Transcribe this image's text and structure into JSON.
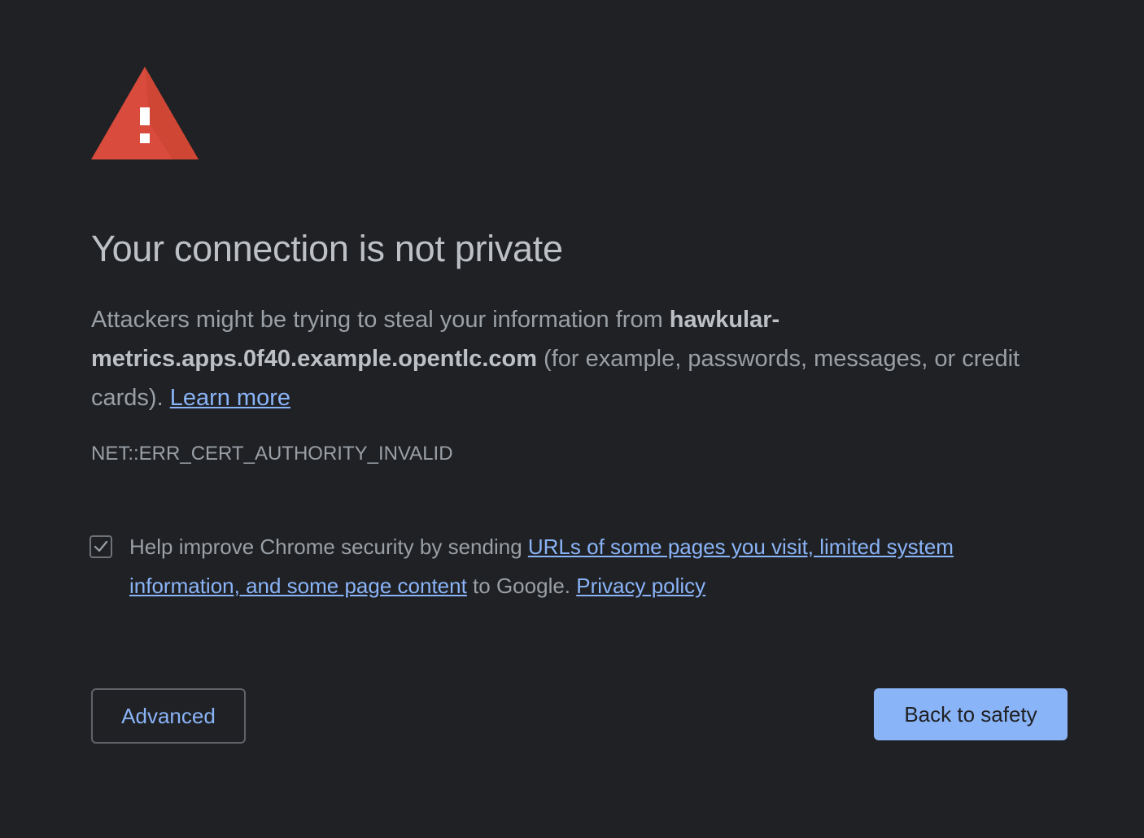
{
  "interstitial": {
    "icon": "warning-triangle-icon",
    "title": "Your connection is not private",
    "message": {
      "prefix": "Attackers might be trying to steal your information from ",
      "hostname": "hawkular-metrics.apps.0f40.example.opentlc.com",
      "suffix": " (for example, passwords, messages, or credit cards). ",
      "learn_more": "Learn more"
    },
    "error_code": "NET::ERR_CERT_AUTHORITY_INVALID"
  },
  "optin": {
    "checked": true,
    "text_prefix": "Help improve Chrome security by sending ",
    "link_text": "URLs of some pages you visit, limited system information, and some page content",
    "text_middle": " to Google. ",
    "privacy_link": "Privacy policy"
  },
  "buttons": {
    "advanced_label": "Advanced",
    "primary_label": "Back to safety"
  },
  "colors": {
    "background": "#202124",
    "warning_red": "#d84b3d",
    "link_blue": "#8ab4f8",
    "text_gray": "#9aa0a6",
    "heading_gray": "#bdc1c6"
  }
}
